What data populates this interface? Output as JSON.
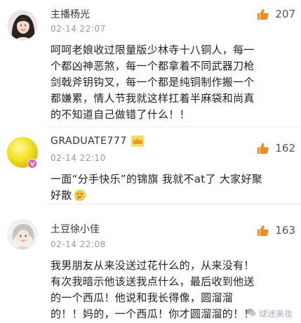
{
  "comments": [
    {
      "username": "主播杨光",
      "timestamp": "02-14 22:07",
      "likes": "207",
      "text_lines": [
        "呵呵老娘收过限量版少林寺十八铜人，每一",
        "个都凶神恶煞，每一个都拿着不同武器刀枪",
        "剑戟斧钥钩叉，每一个都是纯铜制作搬一个",
        "都嫌累，情人节我就这样扛着半麻袋和尚真",
        "的不知道自己做错了什么！！"
      ]
    },
    {
      "username": "GRADUATE777",
      "timestamp": "02-14 22:10",
      "likes": "162",
      "text_lines": [
        "一面“分手快乐”的锦旗 我就不at了 大家好聚",
        "好散"
      ],
      "emoji_icon": "thinking-face-icon"
    },
    {
      "username": "土豆徐小佳",
      "timestamp": "02-14 22:08",
      "likes": "163",
      "text_lines": [
        "我男朋友从来没送过花什么的，从来没有！",
        "有次我暗示他该送我点什么，最后收到他送",
        "的一个西瓜！他说和我长得像，圆溜溜",
        "的！！妈的，一个西瓜！你才圆溜溜的！！"
      ]
    }
  ],
  "watermark": "球迷美妆",
  "colors": {
    "like_icon": "#f08a24",
    "username": "#333333",
    "timestamp": "#999999",
    "text": "#222222"
  },
  "icons": {
    "like": "thumbs-up-icon",
    "badge": "crown-badge-icon",
    "verified": "verified-v-icon"
  }
}
